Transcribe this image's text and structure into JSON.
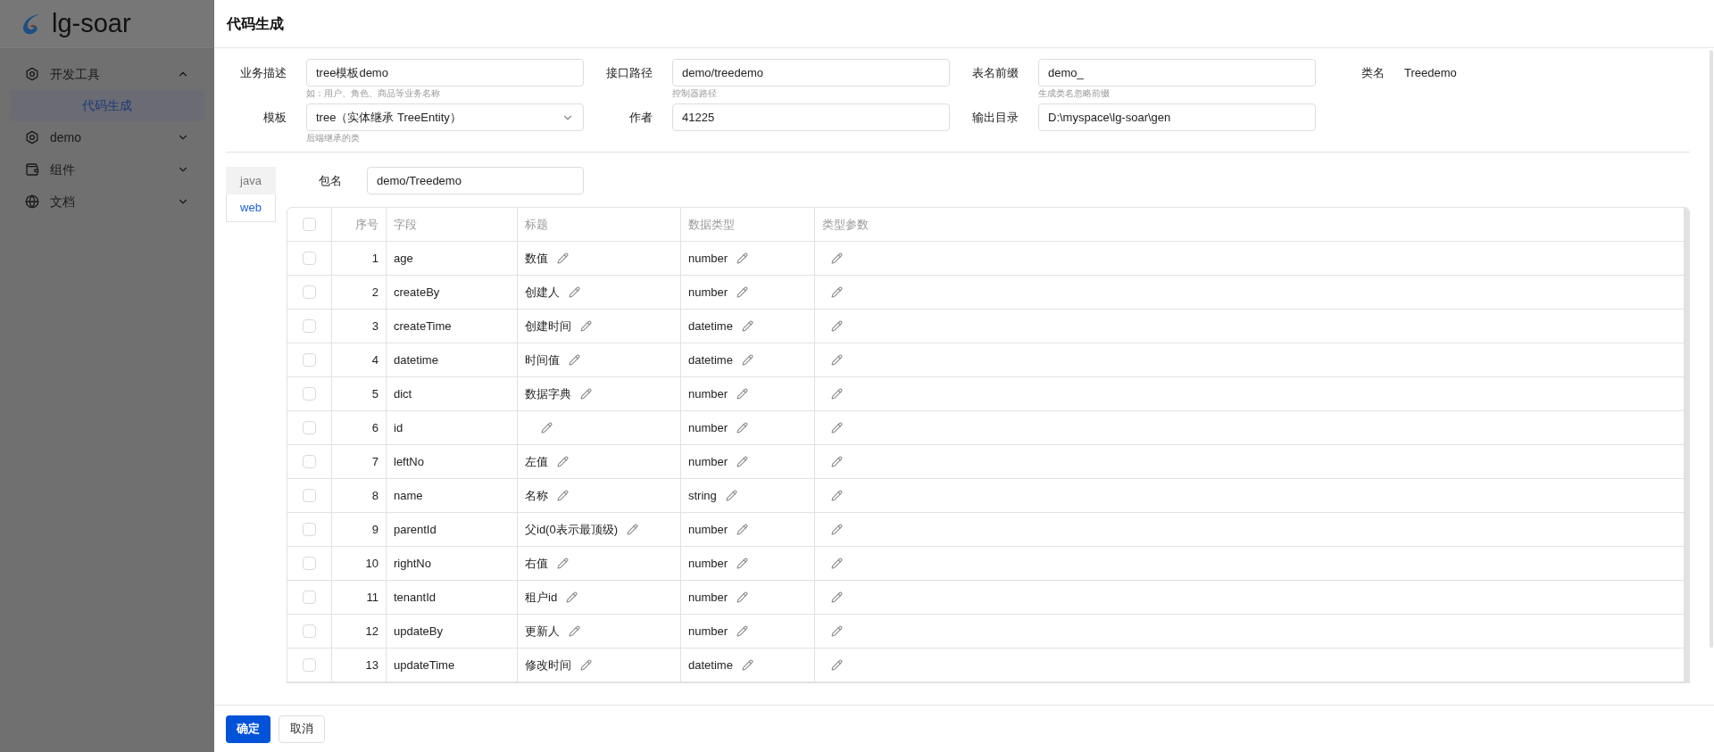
{
  "sidebar": {
    "logo": "lg-soar",
    "items": [
      {
        "label": "开发工具",
        "expanded": true,
        "children": [
          {
            "label": "代码生成",
            "selected": true
          }
        ]
      },
      {
        "label": "demo",
        "expanded": false
      },
      {
        "label": "组件",
        "expanded": false
      },
      {
        "label": "文档",
        "expanded": false
      }
    ]
  },
  "drawer": {
    "title": "代码生成"
  },
  "form": {
    "rows": [
      [
        {
          "kind": "input",
          "label": "业务描述",
          "value": "tree模板demo",
          "help": "如：用户、角色、商品等业务名称"
        },
        {
          "kind": "input",
          "label": "接口路径",
          "value": "demo/treedemo",
          "help": "控制器路径"
        },
        {
          "kind": "input",
          "label": "表名前缀",
          "value": "demo_",
          "help": "生成类名忽略前缀"
        },
        {
          "kind": "text",
          "label": "类名",
          "value": "Treedemo"
        }
      ],
      [
        {
          "kind": "select",
          "label": "模板",
          "value": "tree（实体继承 TreeEntity）",
          "help": "后端继承的类"
        },
        {
          "kind": "input",
          "label": "作者",
          "value": "41225"
        },
        {
          "kind": "input",
          "label": "输出目录",
          "value": "D:\\myspace\\lg-soar\\gen"
        }
      ]
    ]
  },
  "tabs": [
    {
      "label": "java",
      "selected": false
    },
    {
      "label": "web",
      "selected": true
    }
  ],
  "package": {
    "label": "包名",
    "value": "demo/Treedemo"
  },
  "table": {
    "all_checked": false,
    "columns": [
      "序号",
      "字段",
      "标题",
      "数据类型",
      "类型参数"
    ],
    "rows": [
      {
        "checked": false,
        "no": "1",
        "field": "age",
        "title": "数值",
        "type": "number"
      },
      {
        "checked": false,
        "no": "2",
        "field": "createBy",
        "title": "创建人",
        "type": "number"
      },
      {
        "checked": false,
        "no": "3",
        "field": "createTime",
        "title": "创建时间",
        "type": "datetime"
      },
      {
        "checked": false,
        "no": "4",
        "field": "datetime",
        "title": "时间值",
        "type": "datetime"
      },
      {
        "checked": false,
        "no": "5",
        "field": "dict",
        "title": "数据字典",
        "type": "number"
      },
      {
        "checked": false,
        "no": "6",
        "field": "id",
        "type": "number"
      },
      {
        "checked": false,
        "no": "7",
        "field": "leftNo",
        "title": "左值",
        "type": "number"
      },
      {
        "checked": false,
        "no": "8",
        "field": "name",
        "title": "名称",
        "type": "string"
      },
      {
        "checked": false,
        "no": "9",
        "field": "parentId",
        "title": "父id(0表示最顶级)",
        "type": "number"
      },
      {
        "checked": false,
        "no": "10",
        "field": "rightNo",
        "title": "右值",
        "type": "number"
      },
      {
        "checked": false,
        "no": "11",
        "field": "tenantId",
        "title": "租户id",
        "type": "number"
      },
      {
        "checked": false,
        "no": "12",
        "field": "updateBy",
        "title": "更新人",
        "type": "number"
      },
      {
        "checked": false,
        "no": "13",
        "field": "updateTime",
        "title": "修改时间",
        "type": "datetime"
      }
    ]
  },
  "footer": {
    "buttons": [
      {
        "kind": "primary",
        "label": "确定"
      },
      {
        "kind": "default",
        "label": "取消"
      }
    ]
  }
}
